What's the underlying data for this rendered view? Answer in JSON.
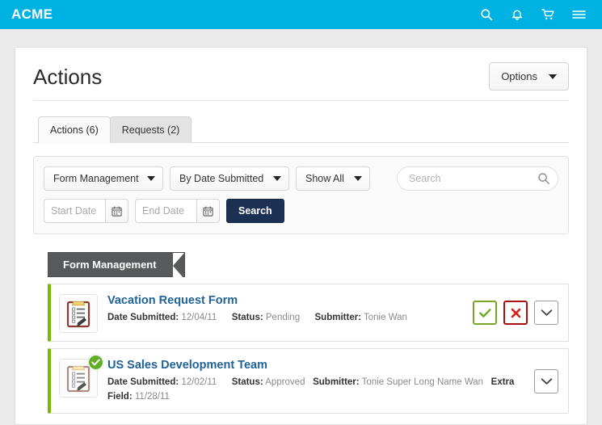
{
  "topbar": {
    "brand": "ACME",
    "icons": [
      {
        "name": "search-icon",
        "glyph": "search"
      },
      {
        "name": "notifications-bell-icon",
        "glyph": "bell"
      },
      {
        "name": "shopping-cart-icon",
        "glyph": "cart"
      },
      {
        "name": "hamburger-menu-icon",
        "glyph": "menu"
      }
    ],
    "background_color": "#00b2e2"
  },
  "page": {
    "title": "Actions",
    "options_button": "Options"
  },
  "tabs": [
    {
      "label": "Actions (6)",
      "active": true
    },
    {
      "label": "Requests (2)",
      "active": false
    }
  ],
  "filters": {
    "form_select": "Form Management",
    "sort_select": "By Date Submitted",
    "show_select": "Show All",
    "search_placeholder": "Search",
    "search_value": "",
    "start_date_placeholder": "Start Date",
    "start_date_value": "",
    "end_date_placeholder": "End Date",
    "end_date_value": "",
    "search_button": "Search"
  },
  "section": {
    "ribbon_label": "Form Management"
  },
  "rows": [
    {
      "title": "Vacation Request Form",
      "date_label": "Date Submitted:",
      "date_value": "12/04/11",
      "status_label": "Status:",
      "status_value": "Pending",
      "submitter_label": "Submitter:",
      "submitter_value": "Tonie Wan",
      "extra_label": "",
      "extra_value": "",
      "approved": false,
      "accent_color": "#7ab800",
      "actions": [
        "approve",
        "reject",
        "expand"
      ]
    },
    {
      "title": "US Sales Development Team",
      "date_label": "Date Submitted:",
      "date_value": "12/02/11",
      "status_label": "Status:",
      "status_value": "Approved",
      "submitter_label": "Submitter:",
      "submitter_value": "Tonie Super Long Name Wan",
      "extra_label": "Extra Field:",
      "extra_value": "11/28/11",
      "approved": true,
      "accent_color": "#7ab800",
      "actions": [
        "expand"
      ]
    }
  ]
}
